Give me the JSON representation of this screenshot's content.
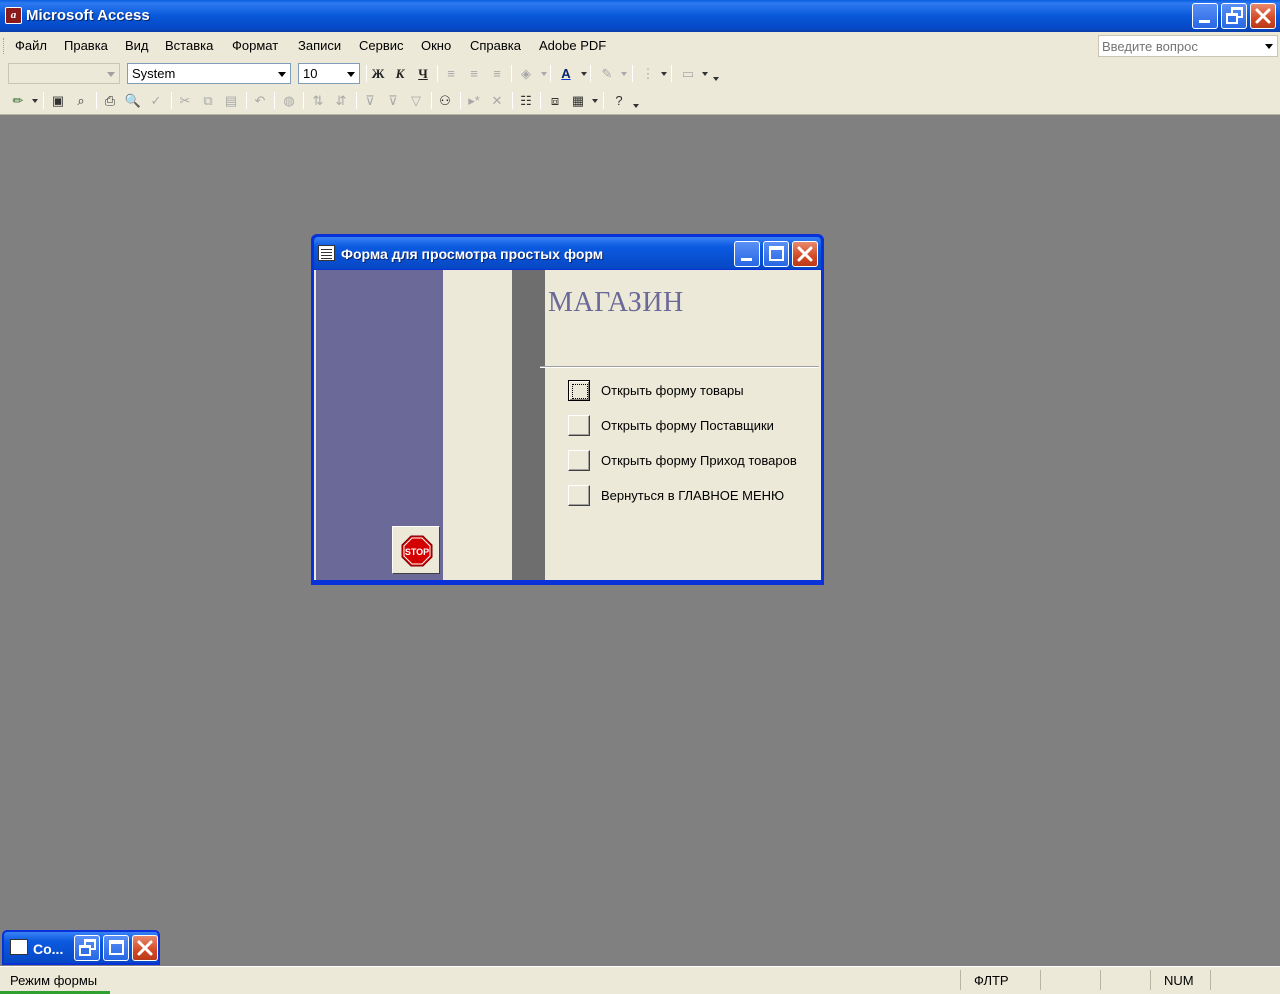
{
  "app": {
    "title": "Microsoft Access",
    "icon": "access-key-icon"
  },
  "menu": {
    "items": [
      "Файл",
      "Правка",
      "Вид",
      "Вставка",
      "Формат",
      "Записи",
      "Сервис",
      "Окно",
      "Справка",
      "Adobe PDF"
    ],
    "help_placeholder": "Введите вопрос"
  },
  "formatting_toolbar": {
    "object_combo": "",
    "font_combo": "System",
    "size_combo": "10",
    "bold": "Ж",
    "italic": "К",
    "underline": "Ч"
  },
  "form_window": {
    "title": "Форма для просмотра простых форм",
    "heading": "МАГАЗИН",
    "buttons": [
      {
        "label": "Открыть форму товары",
        "focused": true
      },
      {
        "label": "Открыть форму Поставщики",
        "focused": false
      },
      {
        "label": "Открыть форму Приход товаров",
        "focused": false
      },
      {
        "label": "Вернуться в ГЛАВНОЕ МЕНЮ",
        "focused": false
      }
    ],
    "stop_label": "STOP",
    "colors": {
      "side_panel": "#6a6998",
      "heading": "#6a6998"
    }
  },
  "minimized_window": {
    "title": "Co..."
  },
  "status": {
    "mode": "Режим формы",
    "filter": "ФЛТР",
    "numlock": "NUM"
  }
}
